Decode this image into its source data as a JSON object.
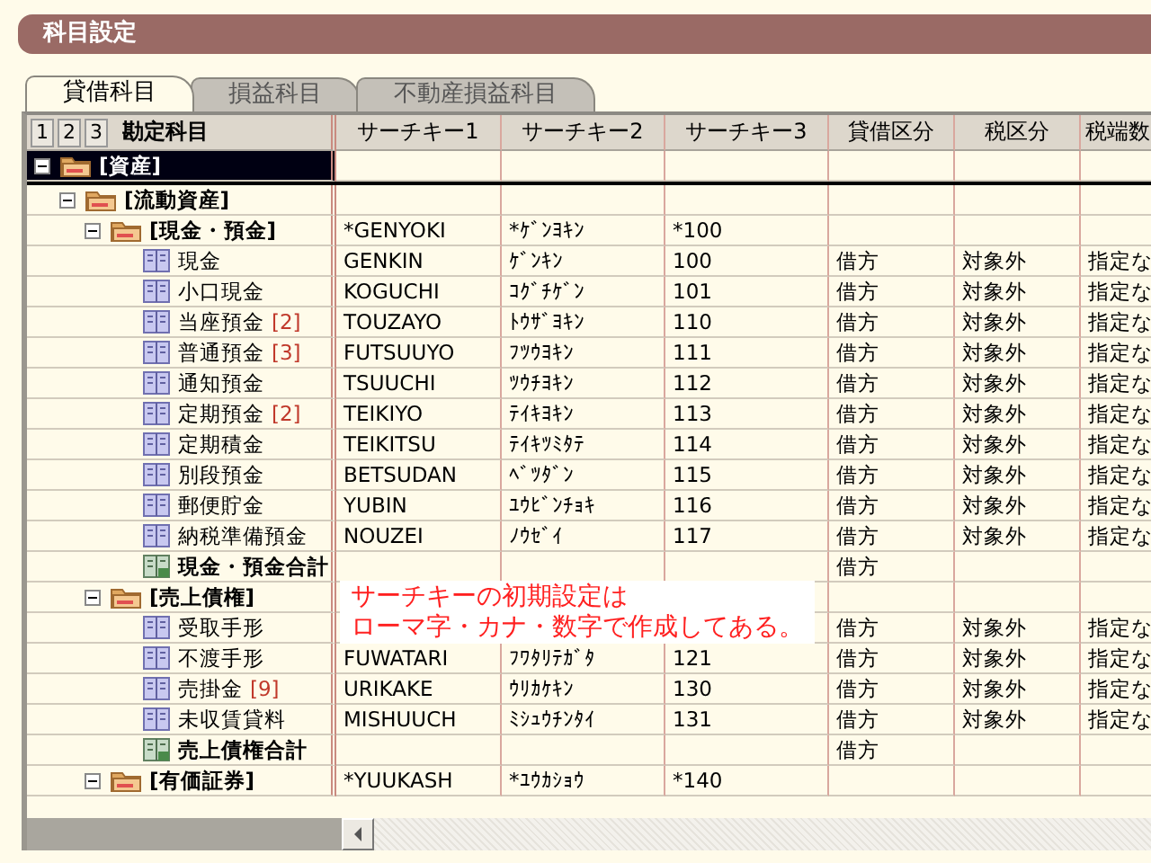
{
  "window": {
    "title": "科目設定"
  },
  "tabs": [
    {
      "label": "貸借科目",
      "selected": true
    },
    {
      "label": "損益科目",
      "selected": false
    },
    {
      "label": "不動産損益科目",
      "selected": false
    }
  ],
  "levels": [
    "1",
    "2",
    "3"
  ],
  "columns": [
    "勘定科目",
    "サーチキー1",
    "サーチキー2",
    "サーチキー3",
    "貸借区分",
    "税区分",
    "税端数"
  ],
  "rows": [
    {
      "kind": "group",
      "name": "[資産]",
      "expanded": true,
      "selected": true,
      "children": [
        {
          "kind": "group",
          "name": "[流動資産]",
          "expanded": true,
          "selected": false,
          "children": [
            {
              "kind": "group",
              "name": "[現金・預金]",
              "expanded": true,
              "selected": false,
              "cells": [
                "*GENYOKI",
                "*ｹﾞﾝﾖｷﾝ",
                "*100"
              ],
              "children": [
                {
                  "kind": "account",
                  "name": "現金",
                  "selected": false,
                  "cells": [
                    "GENKIN",
                    "ｹﾞﾝｷﾝ",
                    "100",
                    "借方",
                    "対象外",
                    "指定な"
                  ]
                },
                {
                  "kind": "account",
                  "name": "小口現金",
                  "selected": false,
                  "cells": [
                    "KOGUCHI",
                    "ｺｸﾞﾁｹﾞﾝ",
                    "101",
                    "借方",
                    "対象外",
                    "指定な"
                  ]
                },
                {
                  "kind": "account",
                  "name": "当座預金",
                  "count": "[2]",
                  "selected": false,
                  "cells": [
                    "TOUZAYO",
                    "ﾄｳｻﾞﾖｷﾝ",
                    "110",
                    "借方",
                    "対象外",
                    "指定な"
                  ]
                },
                {
                  "kind": "account",
                  "name": "普通預金",
                  "count": "[3]",
                  "selected": false,
                  "cells": [
                    "FUTSUUYO",
                    "ﾌﾂｳﾖｷﾝ",
                    "111",
                    "借方",
                    "対象外",
                    "指定な"
                  ]
                },
                {
                  "kind": "account",
                  "name": "通知預金",
                  "selected": false,
                  "cells": [
                    "TSUUCHI",
                    "ﾂｳﾁﾖｷﾝ",
                    "112",
                    "借方",
                    "対象外",
                    "指定な"
                  ]
                },
                {
                  "kind": "account",
                  "name": "定期預金",
                  "count": "[2]",
                  "selected": false,
                  "cells": [
                    "TEIKIYO",
                    "ﾃｲｷﾖｷﾝ",
                    "113",
                    "借方",
                    "対象外",
                    "指定な"
                  ]
                },
                {
                  "kind": "account",
                  "name": "定期積金",
                  "selected": false,
                  "cells": [
                    "TEIKITSU",
                    "ﾃｲｷﾂﾐﾀﾃ",
                    "114",
                    "借方",
                    "対象外",
                    "指定な"
                  ]
                },
                {
                  "kind": "account",
                  "name": "別段預金",
                  "selected": false,
                  "cells": [
                    "BETSUDAN",
                    "ﾍﾞﾂﾀﾞﾝ",
                    "115",
                    "借方",
                    "対象外",
                    "指定な"
                  ]
                },
                {
                  "kind": "account",
                  "name": "郵便貯金",
                  "selected": false,
                  "cells": [
                    "YUBIN",
                    "ﾕｳﾋﾞﾝﾁｮｷ",
                    "116",
                    "借方",
                    "対象外",
                    "指定な"
                  ]
                },
                {
                  "kind": "account",
                  "name": "納税準備預金",
                  "selected": false,
                  "cells": [
                    "NOUZEI",
                    "ﾉｳｾﾞｲ",
                    "117",
                    "借方",
                    "対象外",
                    "指定な"
                  ]
                },
                {
                  "kind": "total",
                  "name": "現金・預金合計",
                  "selected": false,
                  "cells": [
                    null,
                    null,
                    null,
                    "借方"
                  ]
                }
              ]
            },
            {
              "kind": "group",
              "name": "[売上債権]",
              "expanded": true,
              "selected": false,
              "children": [
                {
                  "kind": "account",
                  "name": "受取手形",
                  "selected": false,
                  "cells": [
                    null,
                    null,
                    null,
                    "借方",
                    "対象外",
                    "指定な"
                  ]
                },
                {
                  "kind": "account",
                  "name": "不渡手形",
                  "selected": false,
                  "cells": [
                    "FUWATARI",
                    "ﾌﾜﾀﾘﾃｶﾞﾀ",
                    "121",
                    "借方",
                    "対象外",
                    "指定な"
                  ]
                },
                {
                  "kind": "account",
                  "name": "売掛金",
                  "count": "[9]",
                  "selected": false,
                  "cells": [
                    "URIKAKE",
                    "ｳﾘｶｹｷﾝ",
                    "130",
                    "借方",
                    "対象外",
                    "指定な"
                  ]
                },
                {
                  "kind": "account",
                  "name": "未収賃貸料",
                  "selected": false,
                  "cells": [
                    "MISHUUCH",
                    "ﾐｼｭｳﾁﾝﾀｲ",
                    "131",
                    "借方",
                    "対象外",
                    "指定な"
                  ]
                },
                {
                  "kind": "total",
                  "name": "売上債権合計",
                  "selected": false,
                  "cells": [
                    null,
                    null,
                    null,
                    "借方"
                  ]
                }
              ]
            },
            {
              "kind": "group",
              "name": "[有価証券]",
              "expanded": true,
              "selected": false,
              "cells": [
                "*YUUKASH",
                "*ﾕｳｶｼｮｳ",
                "*140"
              ]
            }
          ]
        }
      ]
    }
  ],
  "callout": {
    "lines": [
      "サーチキーの初期設定は",
      "ローマ字・カナ・数字で作成してある。"
    ]
  }
}
